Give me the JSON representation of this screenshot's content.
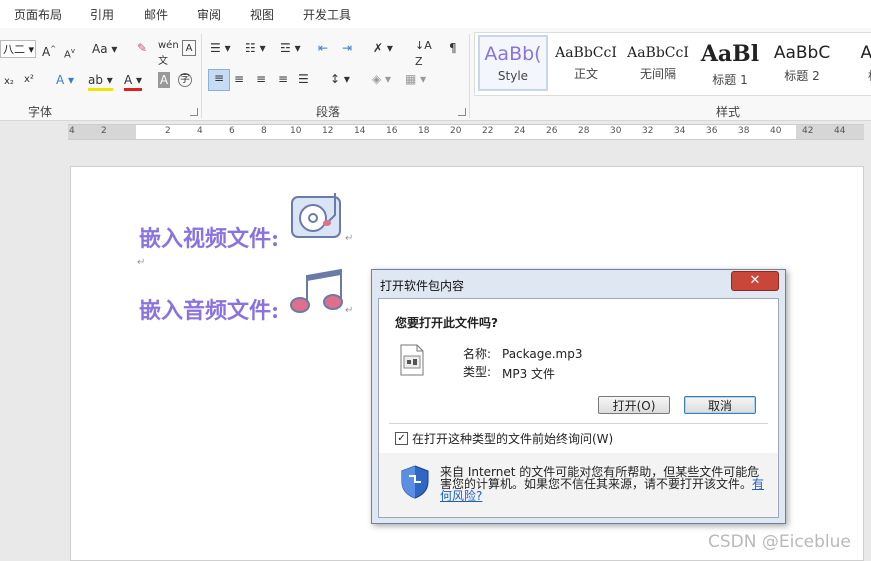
{
  "tabs": [
    "页面布局",
    "引用",
    "邮件",
    "审阅",
    "视图",
    "开发工具"
  ],
  "ribbon": {
    "font_group": "字体",
    "paragraph_group": "段落",
    "styles_group": "样式",
    "font_size": "八二",
    "case_label": "Aa",
    "styles": [
      {
        "sample": "AaBb(",
        "name": "Style"
      },
      {
        "sample": "AaBbCcI",
        "name": "正文"
      },
      {
        "sample": "AaBbCcI",
        "name": "无间隔"
      },
      {
        "sample": "AaBl",
        "name": "标题 1"
      },
      {
        "sample": "AaBbC",
        "name": "标题 2"
      },
      {
        "sample": "AaI",
        "name": "标"
      }
    ]
  },
  "ruler": [
    "4",
    "2",
    "2",
    "4",
    "6",
    "8",
    "10",
    "12",
    "14",
    "16",
    "18",
    "20",
    "22",
    "24",
    "26",
    "28",
    "30",
    "32",
    "34",
    "36",
    "38",
    "40",
    "42",
    "44"
  ],
  "document": {
    "line1": "嵌入视频文件:",
    "line2": "嵌入音频文件:",
    "para_mark": "↵"
  },
  "dialog": {
    "title": "打开软件包内容",
    "close": "✕",
    "question": "您要打开此文件吗?",
    "name_label": "名称:",
    "name_value": "Package.mp3",
    "type_label": "类型:",
    "type_value": "MP3 文件",
    "open_button": "打开(O)",
    "cancel_button": "取消",
    "checkbox_label": "在打开这种类型的文件前始终询问(W)",
    "checkbox_checked": "✓",
    "warning": "来自 Internet 的文件可能对您有所帮助，但某些文件可能危害您的计算机。如果您不信任其来源，请不要打开该文件。",
    "risk_link": "有何风险?"
  },
  "watermark": "CSDN @Eiceblue",
  "colors": {
    "accent": "#8a73e0",
    "close": "#c9473a",
    "link": "#1a5fc0"
  }
}
